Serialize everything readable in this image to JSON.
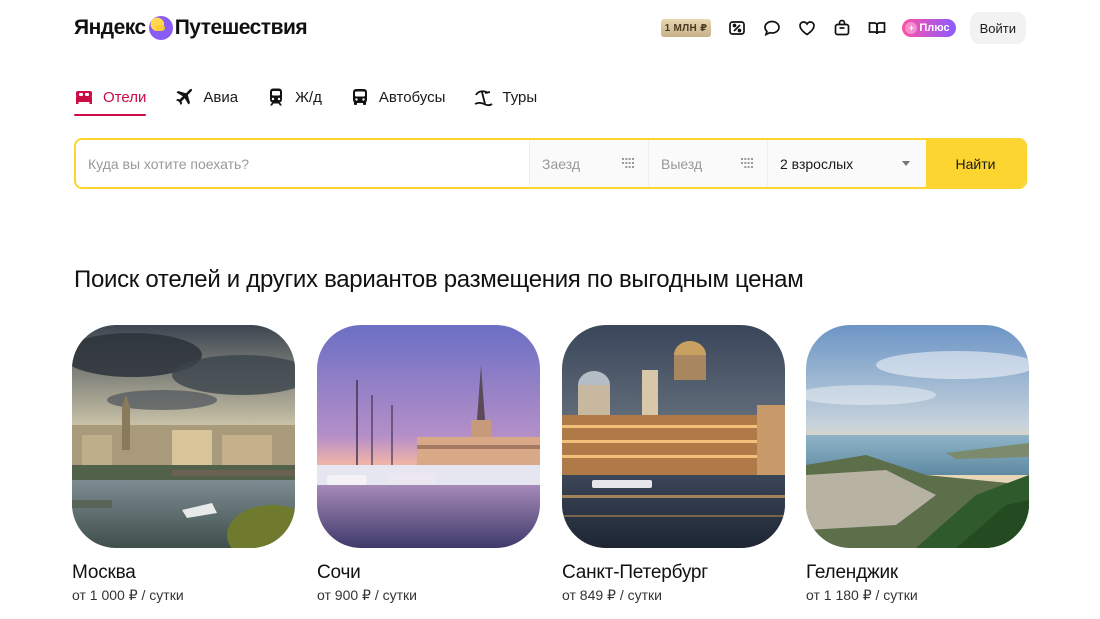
{
  "header": {
    "logo_left": "Яндекс",
    "logo_right": "Путешествия",
    "mln_badge": "1 МЛН ₽",
    "icons": [
      "discount-icon",
      "chat-icon",
      "heart-icon",
      "bag-icon",
      "book-icon"
    ],
    "plus_label": "Плюс",
    "login_label": "Войти"
  },
  "tabs": [
    {
      "label": "Отели",
      "icon": "bed-icon",
      "active": true
    },
    {
      "label": "Авиа",
      "icon": "plane-icon",
      "active": false
    },
    {
      "label": "Ж/д",
      "icon": "train-icon",
      "active": false
    },
    {
      "label": "Автобусы",
      "icon": "bus-icon",
      "active": false
    },
    {
      "label": "Туры",
      "icon": "tour-icon",
      "active": false
    }
  ],
  "search": {
    "where_placeholder": "Куда вы хотите поехать?",
    "checkin_label": "Заезд",
    "checkout_label": "Выезд",
    "guests_value": "2 взрослых",
    "submit_label": "Найти"
  },
  "main": {
    "heading": "Поиск отелей и других вариантов размещения по выгодным ценам",
    "cards": [
      {
        "city": "Москва",
        "price": "от 1 000 ₽ / сутки"
      },
      {
        "city": "Сочи",
        "price": "от 900 ₽ / сутки"
      },
      {
        "city": "Санкт-Петербург",
        "price": "от 849 ₽ / сутки"
      },
      {
        "city": "Геленджик",
        "price": "от 1 180 ₽ / сутки"
      }
    ]
  },
  "colors": {
    "accent_yellow": "#fcd531",
    "active_tab": "#cc0a44"
  }
}
